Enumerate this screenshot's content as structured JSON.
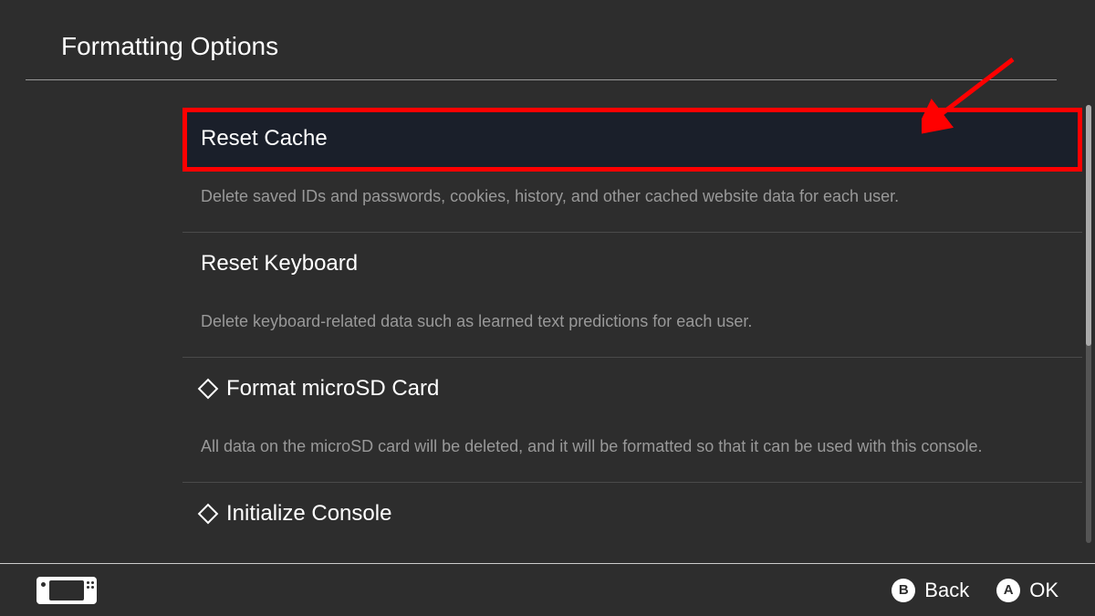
{
  "header": {
    "title": "Formatting Options"
  },
  "options": [
    {
      "label": "Reset Cache",
      "desc": "Delete saved IDs and passwords, cookies, history, and other cached website data for each user.",
      "hasIcon": false
    },
    {
      "label": "Reset Keyboard",
      "desc": "Delete keyboard-related data such as learned text predictions for each user.",
      "hasIcon": false
    },
    {
      "label": "Format microSD Card",
      "desc": "All data on the microSD card will be deleted, and it will be formatted so that it can be used with this console.",
      "hasIcon": true
    },
    {
      "label": "Initialize Console",
      "desc": "",
      "hasIcon": true
    }
  ],
  "footer": {
    "back": {
      "key": "B",
      "label": "Back"
    },
    "ok": {
      "key": "A",
      "label": "OK"
    }
  },
  "annotation": {
    "highlightColor": "#ff0000",
    "arrowColor": "#ff0000"
  }
}
